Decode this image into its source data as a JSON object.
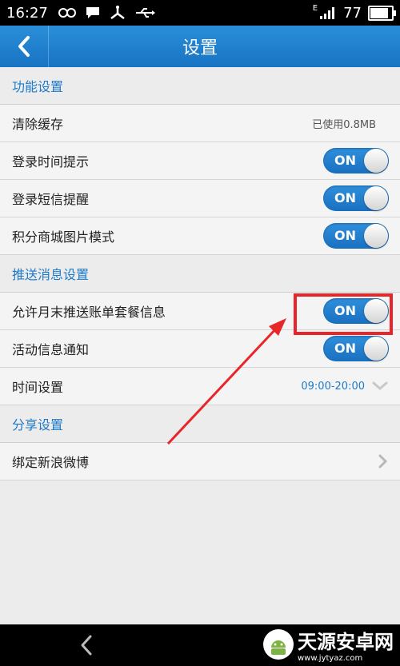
{
  "status_bar": {
    "time": "16:27",
    "battery": "77",
    "battery_level": 0.77,
    "network": "E"
  },
  "header": {
    "title": "设置"
  },
  "sections": [
    {
      "title": "功能设置",
      "items": [
        {
          "label": "清除缓存",
          "value": "已使用0.8MB"
        },
        {
          "label": "登录时间提示",
          "toggle": "ON"
        },
        {
          "label": "登录短信提醒",
          "toggle": "ON"
        },
        {
          "label": "积分商城图片模式",
          "toggle": "ON"
        }
      ]
    },
    {
      "title": "推送消息设置",
      "items": [
        {
          "label": "允许月末推送账单套餐信息",
          "toggle": "ON"
        },
        {
          "label": "活动信息通知",
          "toggle": "ON"
        },
        {
          "label": "时间设置",
          "value": "09:00-20:00"
        }
      ]
    },
    {
      "title": "分享设置",
      "items": [
        {
          "label": "绑定新浪微博"
        }
      ]
    }
  ],
  "watermark": {
    "name": "天源安卓网",
    "url": "www.jytyaz.com"
  },
  "colors": {
    "accent": "#1e7ac9",
    "annotation": "#e8262a"
  }
}
